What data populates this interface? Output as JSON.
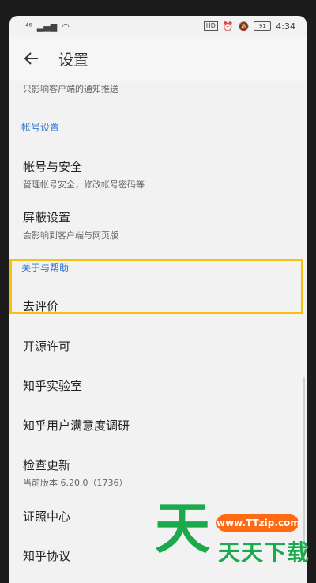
{
  "status": {
    "signal": "⁴⁶",
    "hd": "HD",
    "battery": "91",
    "time": "4:34"
  },
  "appbar": {
    "title": "设置"
  },
  "partial_item": {
    "subtitle": "只影响客户端的通知推送"
  },
  "account_section": {
    "header": "帐号设置",
    "items": [
      {
        "title": "帐号与安全",
        "subtitle": "管理帐号安全，修改帐号密码等"
      },
      {
        "title": "屏蔽设置",
        "subtitle": "会影响到客户端与网页版"
      }
    ]
  },
  "help_section": {
    "header": "关于与帮助",
    "items": [
      {
        "title": "去评价"
      },
      {
        "title": "开源许可"
      },
      {
        "title": "知乎实验室"
      },
      {
        "title": "知乎用户满意度调研"
      },
      {
        "title": "检查更新",
        "subtitle": "当前版本 6.20.0（1736）"
      },
      {
        "title": "证照中心"
      },
      {
        "title": "知乎协议"
      }
    ]
  },
  "watermark": {
    "big": "天",
    "url": "www.TTzip.com",
    "name": "天天下载",
    "color": "#1aaa4b"
  }
}
